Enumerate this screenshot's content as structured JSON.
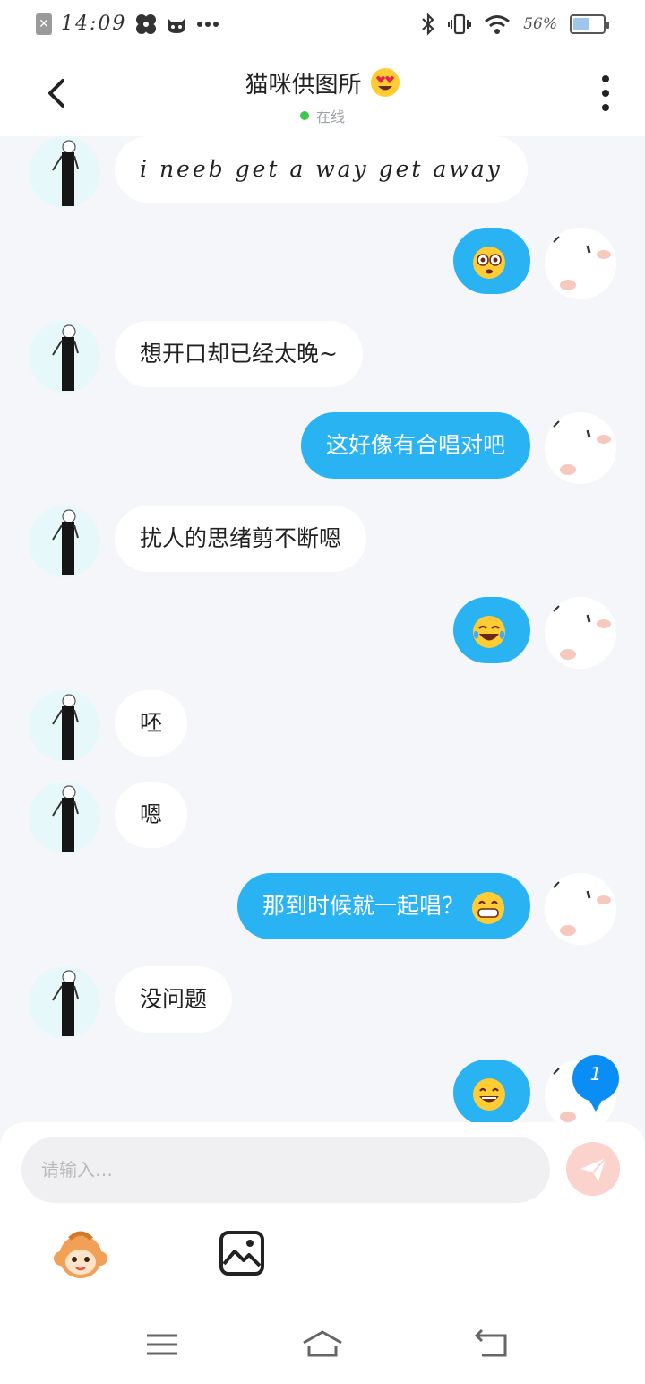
{
  "status_bar": {
    "time": "14:09",
    "battery_text": "56%",
    "battery_level": 0.56,
    "icons": [
      "close-icon",
      "pinwheel-icon",
      "cat-face-icon",
      "more-dots-icon",
      "bluetooth-icon",
      "vibrate-icon",
      "wifi-icon",
      "battery-icon"
    ]
  },
  "header": {
    "title": "猫咪供图所",
    "title_emoji": "heart-eyes-emoji",
    "status": "在线",
    "status_color": "#3dc94f"
  },
  "messages": [
    {
      "side": "left",
      "text": "i  neeb  get  a  way  get  away"
    },
    {
      "side": "right",
      "text": "",
      "emoji": "flushed-emoji"
    },
    {
      "side": "left",
      "text": "想开口却已经太晚~"
    },
    {
      "side": "right",
      "text": "这好像有合唱对吧"
    },
    {
      "side": "left",
      "text": "扰人的思绪剪不断嗯"
    },
    {
      "side": "right",
      "text": "",
      "emoji": "tears-of-joy-emoji"
    },
    {
      "side": "left",
      "text": "呸"
    },
    {
      "side": "left",
      "text": "嗯"
    },
    {
      "side": "right",
      "text": "那到时候就一起唱？",
      "emoji": "grinning-emoji"
    },
    {
      "side": "left",
      "text": "没问题"
    },
    {
      "side": "right",
      "text": "",
      "emoji": "smile-emoji"
    }
  ],
  "unread_badge": "1",
  "composer": {
    "placeholder": "请输入…",
    "send_icon": "send-icon",
    "tools": [
      "mascot-sticker-icon",
      "image-icon"
    ]
  },
  "nav": {
    "icons": [
      "menu-icon",
      "home-icon",
      "back-icon"
    ]
  },
  "colors": {
    "accent": "#29b3f2",
    "background": "#f4f6f9",
    "send_disabled": "#fbd2cc"
  }
}
